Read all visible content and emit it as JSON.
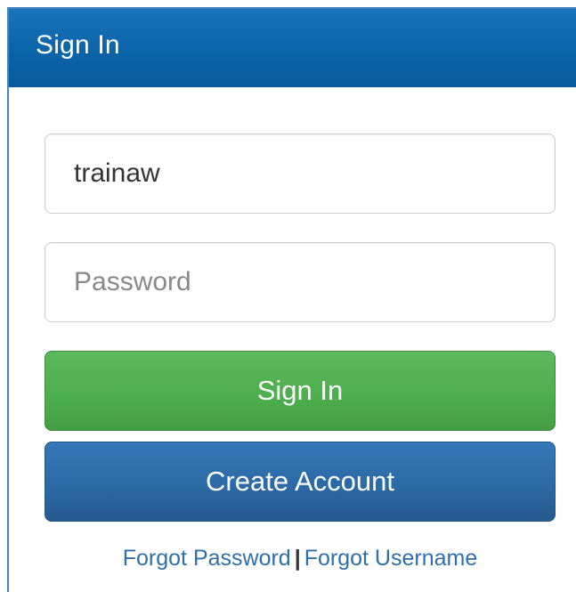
{
  "header": {
    "title": "Sign In"
  },
  "form": {
    "username_value": "trainaw",
    "password_placeholder": "Password",
    "signin_label": "Sign In",
    "create_account_label": "Create Account"
  },
  "links": {
    "forgot_password": "Forgot Password",
    "separator": "|",
    "forgot_username": "Forgot Username"
  },
  "colors": {
    "header_bg": "#0b63a8",
    "signin_btn": "#5cb85c",
    "create_btn": "#2c6aa6",
    "link": "#2f6fab"
  }
}
